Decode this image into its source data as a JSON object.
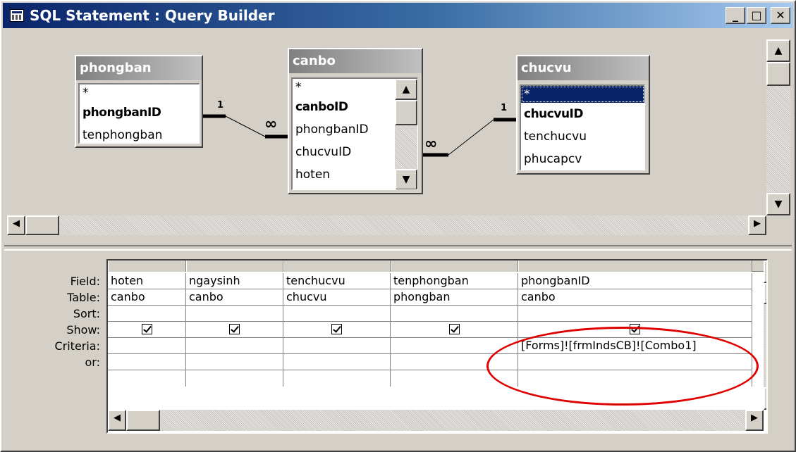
{
  "window": {
    "title": "SQL Statement : Query Builder",
    "min_label": "_",
    "max_label": "□",
    "close_label": "✕"
  },
  "tables": [
    {
      "name": "phongban",
      "fields": [
        {
          "label": "*",
          "key": false,
          "selected": false
        },
        {
          "label": "phongbanID",
          "key": true,
          "selected": false
        },
        {
          "label": "tenphongban",
          "key": false,
          "selected": false
        }
      ]
    },
    {
      "name": "canbo",
      "fields": [
        {
          "label": "*",
          "key": false,
          "selected": false
        },
        {
          "label": "canboID",
          "key": true,
          "selected": false
        },
        {
          "label": "phongbanID",
          "key": false,
          "selected": false
        },
        {
          "label": "chucvuID",
          "key": false,
          "selected": false
        },
        {
          "label": "hoten",
          "key": false,
          "selected": false
        }
      ]
    },
    {
      "name": "chucvu",
      "fields": [
        {
          "label": "*",
          "key": false,
          "selected": true
        },
        {
          "label": "chucvuID",
          "key": true,
          "selected": false
        },
        {
          "label": "tenchucvu",
          "key": false,
          "selected": false
        },
        {
          "label": "phucapcv",
          "key": false,
          "selected": false
        }
      ]
    }
  ],
  "relationships": [
    {
      "one_label": "1",
      "many_label": "∞"
    },
    {
      "one_label": "1",
      "many_label": "∞"
    }
  ],
  "grid": {
    "row_labels": [
      "Field:",
      "Table:",
      "Sort:",
      "Show:",
      "Criteria:",
      "or:"
    ],
    "columns": [
      {
        "field": "hoten",
        "table": "canbo",
        "sort": "",
        "show": true,
        "criteria": "",
        "or": ""
      },
      {
        "field": "ngaysinh",
        "table": "canbo",
        "sort": "",
        "show": true,
        "criteria": "",
        "or": ""
      },
      {
        "field": "tenchucvu",
        "table": "chucvu",
        "sort": "",
        "show": true,
        "criteria": "",
        "or": ""
      },
      {
        "field": "tenphongban",
        "table": "phongban",
        "sort": "",
        "show": true,
        "criteria": "",
        "or": ""
      },
      {
        "field": "phongbanID",
        "table": "canbo",
        "sort": "",
        "show": true,
        "criteria": "[Forms]![frmIndsCB]![Combo1]",
        "or": ""
      }
    ]
  },
  "annotation_color": "#e00000",
  "icons": {
    "scroll_up": "▲",
    "scroll_down": "▼",
    "scroll_left": "◀",
    "scroll_right": "▶"
  }
}
